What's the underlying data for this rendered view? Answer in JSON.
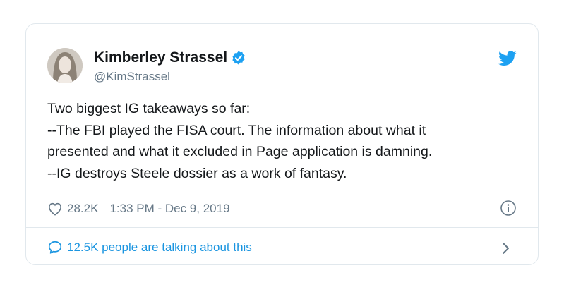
{
  "tweet": {
    "author_name": "Kimberley Strassel",
    "author_handle": "@KimStrassel",
    "lines": [
      "Two biggest IG takeaways so far:",
      "--The FBI played the FISA court. The information about what it",
      "presented and what it excluded in Page application is damning.",
      "--IG destroys Steele dossier as a work of fantasy."
    ],
    "likes": "28.2K",
    "timestamp": "1:33 PM - Dec 9, 2019",
    "talking": "12.5K people are talking about this"
  },
  "icons": {
    "verified": "verified-badge-icon",
    "brand": "twitter-bird-icon",
    "like": "heart-icon",
    "info": "info-icon",
    "reply": "speech-bubble-icon",
    "chevron": "chevron-right-icon"
  },
  "colors": {
    "accent": "#1da1f2",
    "link": "#1b95e0",
    "muted": "#657786",
    "border": "#e1e8ed"
  }
}
